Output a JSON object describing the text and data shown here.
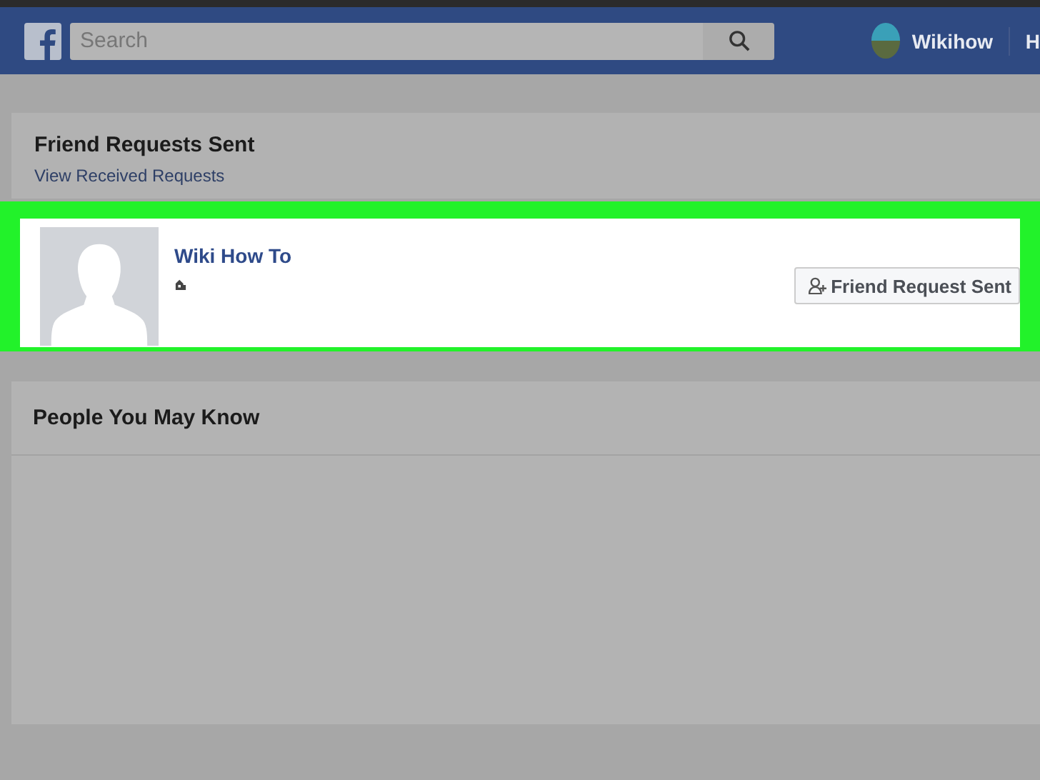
{
  "top_bar": {
    "search": {
      "placeholder": "Search"
    },
    "profile_name": "Wikihow",
    "next_item": "H"
  },
  "sent_requests": {
    "title": "Friend Requests Sent",
    "link": "View Received Requests",
    "highlighted": true,
    "requests": [
      {
        "name": "Wiki How To",
        "button": "Friend Request Sent"
      }
    ]
  },
  "people_you_may_know": {
    "title": "People You May Know"
  }
}
